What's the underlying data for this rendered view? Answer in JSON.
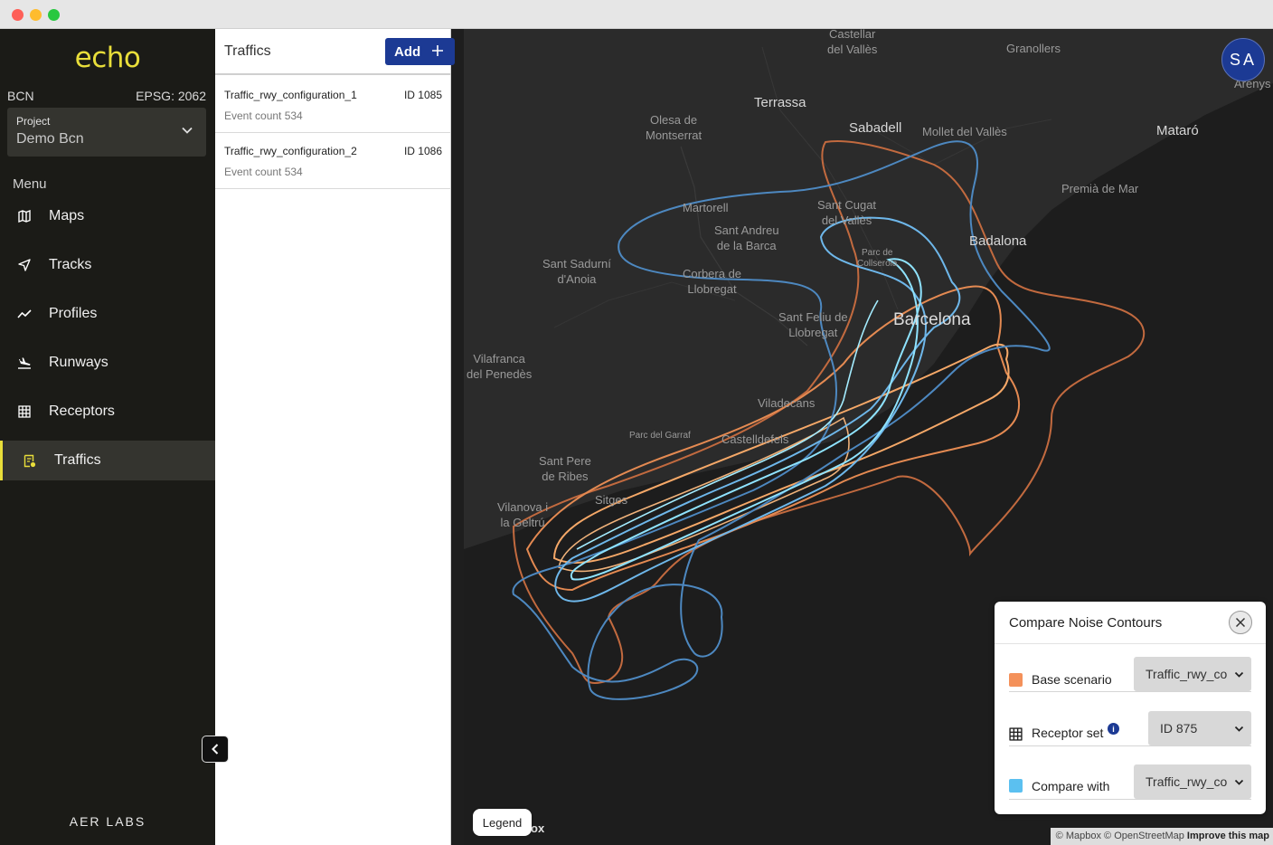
{
  "app": {
    "logo": "echo",
    "region": "BCN",
    "epsg": "EPSG: 2062",
    "company": "AER LABS",
    "accent_color": "#e9de3a",
    "brand_blue": "#1c3a94"
  },
  "project": {
    "label": "Project",
    "value": "Demo Bcn"
  },
  "menu": {
    "title": "Menu",
    "items": [
      {
        "label": "Maps",
        "icon": "map-icon"
      },
      {
        "label": "Tracks",
        "icon": "navigation-arrow-icon"
      },
      {
        "label": "Profiles",
        "icon": "trend-line-icon"
      },
      {
        "label": "Runways",
        "icon": "plane-landing-icon"
      },
      {
        "label": "Receptors",
        "icon": "grid-icon"
      },
      {
        "label": "Traffics",
        "icon": "traffic-list-icon",
        "active": true
      }
    ]
  },
  "traffics": {
    "title": "Traffics",
    "add_label": "Add",
    "items": [
      {
        "name": "Traffic_rwy_configuration_1",
        "id": "ID 1085",
        "count": "Event count 534"
      },
      {
        "name": "Traffic_rwy_configuration_2",
        "id": "ID 1086",
        "count": "Event count 534"
      }
    ]
  },
  "map": {
    "avatar": "SA",
    "legend_label": "Legend",
    "mapbox_label": "ox",
    "attribution": {
      "mapbox": "© Mapbox",
      "osm": "© OpenStreetMap",
      "improve": "Improve this map"
    },
    "places": {
      "castellar": "Castellar\ndel Vallès",
      "granollers": "Granollers",
      "arenys": "Arenys",
      "terrassa": "Terrassa",
      "sabadell": "Sabadell",
      "mollet": "Mollet del Vallès",
      "mataro": "Mataró",
      "olesa": "Olesa de\nMontserrat",
      "premia": "Premià de Mar",
      "martorell": "Martorell",
      "santcugat": "Sant Cugat\ndel Vallès",
      "santandreu": "Sant Andreu\nde la Barca",
      "badalona": "Badalona",
      "collserola": "Parc de\nCollserola",
      "santsadurni": "Sant Sadurní\nd'Anoia",
      "corbera": "Corbera de\nLlobregat",
      "santfeliu": "Sant Feliu de\nLlobregat",
      "barcelona": "Barcelona",
      "vilafranca": "Vilafranca\ndel Penedès",
      "viladecans": "Viladecans",
      "garraf": "Parc del Garraf",
      "castelldefels": "Castelldefels",
      "santpere": "Sant Pere\nde Ribes",
      "sitges": "Sitges",
      "vilanova": "Vilanova i\nla Geltrú"
    }
  },
  "compare": {
    "title": "Compare Noise Contours",
    "base": {
      "label": "Base scenario",
      "value": "Traffic_rwy_co",
      "color": "#f4915a"
    },
    "receptor": {
      "label": "Receptor set",
      "value": "ID 875",
      "info": "i"
    },
    "compare_with": {
      "label": "Compare with",
      "value": "Traffic_rwy_co",
      "color": "#5bc0f0"
    }
  }
}
